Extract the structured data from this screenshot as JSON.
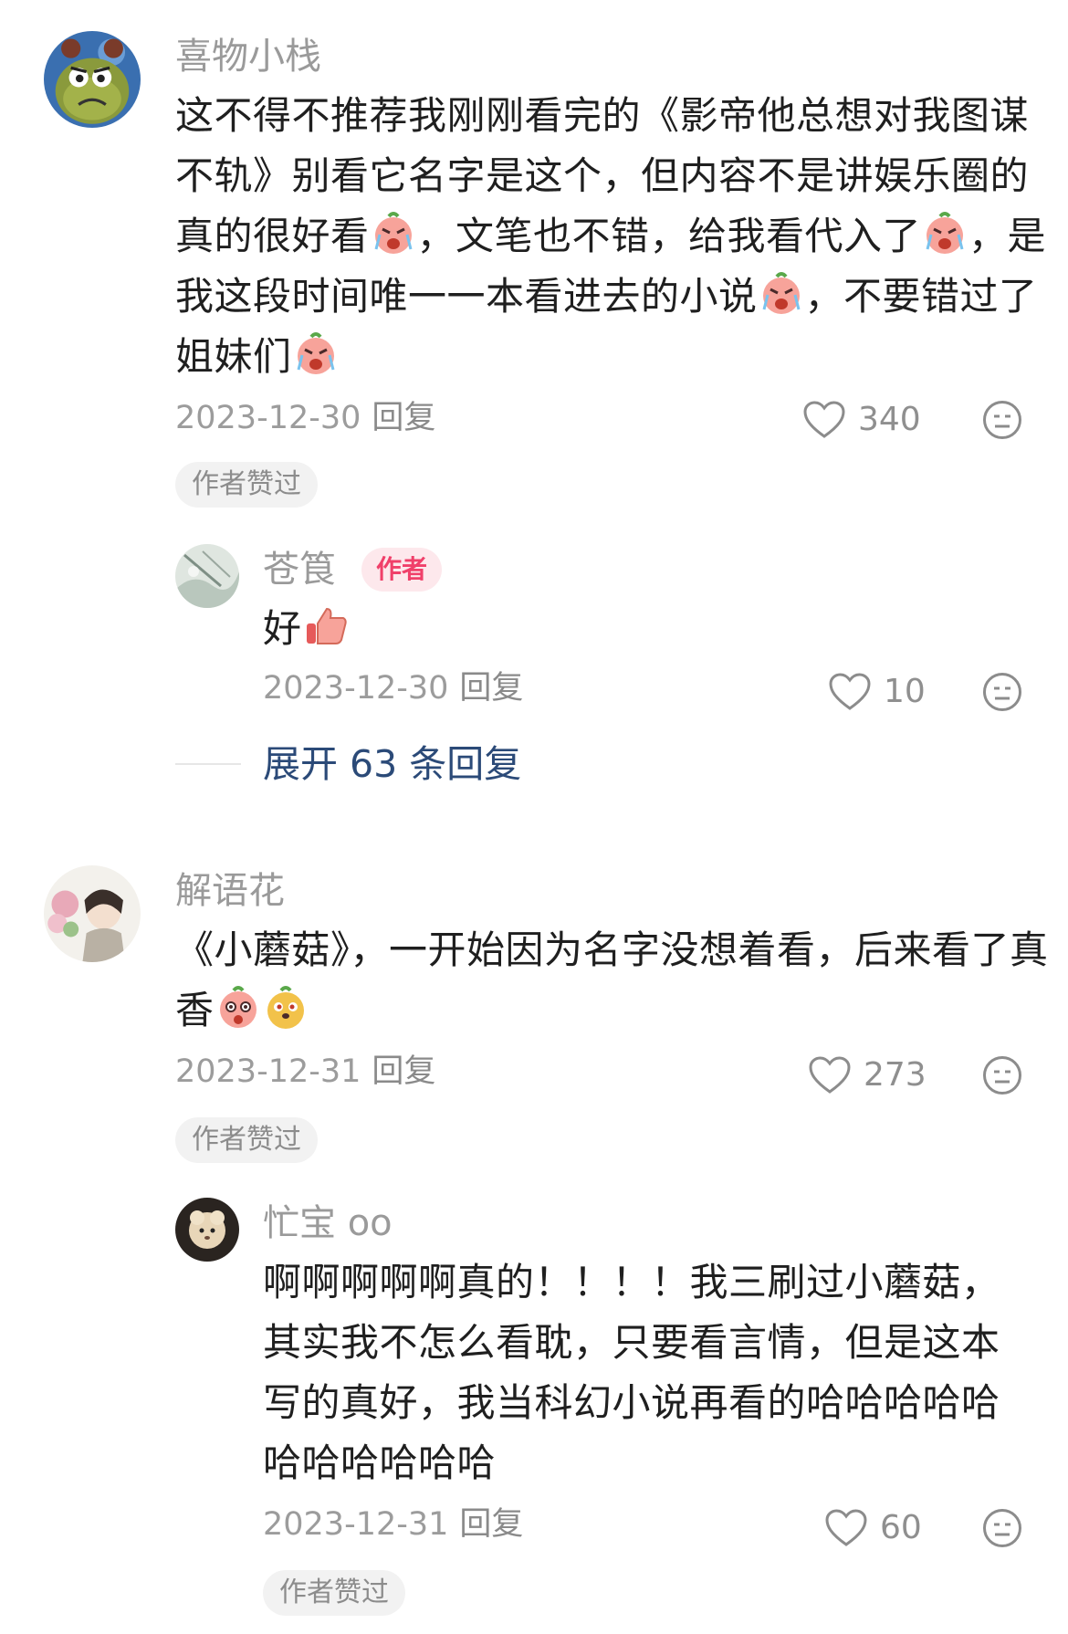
{
  "comments": [
    {
      "username": "喜物小栈",
      "text_parts": [
        "这不得不推荐我刚刚看完的《影帝他总想对我图谋不轨》别看它名字是这个，但内容不是讲娱乐圈的真的很好看",
        "，文笔也不错，给我看代入了",
        "，是我这段时间唯一一本看进去的小说",
        "，不要错过了姐妹们",
        ""
      ],
      "date": "2023-12-30",
      "reply_label": "回复",
      "likes": "340",
      "author_liked": "作者赞过"
    },
    {
      "username": "苍筤",
      "author_tag": "作者",
      "text": "好",
      "date": "2023-12-30",
      "reply_label": "回复",
      "likes": "10"
    },
    {
      "expand_label": "展开 63 条回复"
    },
    {
      "username": "解语花",
      "text": "《小蘑菇》，一开始因为名字没想着看，后来看了真香",
      "date": "2023-12-31",
      "reply_label": "回复",
      "likes": "273",
      "author_liked": "作者赞过"
    },
    {
      "username": "忙宝 oo",
      "text": "啊啊啊啊啊真的！！！！我三刷过小蘑菇，其实我不怎么看耽，只要看言情，但是这本写的真好，我当科幻小说再看的哈哈哈哈哈哈哈哈哈哈哈",
      "date": "2023-12-31",
      "reply_label": "回复",
      "likes": "60",
      "author_liked": "作者赞过"
    }
  ],
  "colors": {
    "author_tag": "#f0406a",
    "expand_link": "#2b4a78",
    "meta_gray": "#9c9c9c"
  },
  "icons": [
    "heart-icon",
    "dislike-face-icon",
    "crying-emoji-icon",
    "thumbs-up-emoji-icon",
    "surprised-emoji-icon",
    "doge-emoji-icon"
  ]
}
